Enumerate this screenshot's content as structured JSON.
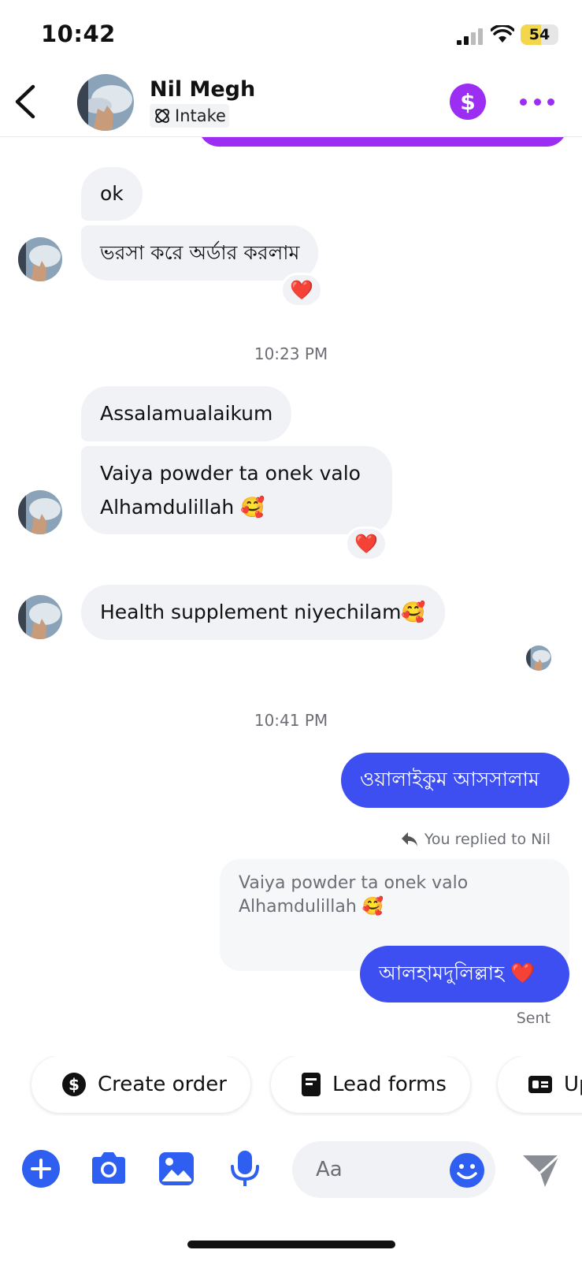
{
  "status_bar": {
    "time": "10:42",
    "battery": "54",
    "battery_level": 0.54
  },
  "header": {
    "name": "Nil Megh",
    "label_tag": "Intake",
    "accent_color": "#9b2ef2"
  },
  "messages": {
    "m1": "ok",
    "m2": "ভরসা করে অর্ডার করলাম",
    "ts1": "10:23 PM",
    "m3": "Assalamualaikum",
    "m4_line1": "Vaiya powder ta onek valo",
    "m4_line2": "Alhamdulillah 🥰",
    "m5": "Health supplement niyechilam🥰",
    "ts2": "10:41 PM",
    "out1": "ওয়ালাইকুম আসসালাম",
    "reply_note": "You replied to Nil",
    "quoted_line1": "Vaiya powder ta onek valo",
    "quoted_line2": "Alhamdulillah 🥰",
    "out2": "আলহামদুলিল্লাহ ❤️",
    "sent_status": "Sent",
    "reaction": "❤️"
  },
  "colors": {
    "outgoing_bubble": "#3d4ff0",
    "incoming_bubble": "#f1f2f5",
    "accent": "#9b2ef2",
    "composer_icons": "#2f5ff0"
  },
  "quick_actions": [
    {
      "label": "Create order",
      "icon": "dollar-circle-icon"
    },
    {
      "label": "Lead forms",
      "icon": "form-icon"
    },
    {
      "label": "Up",
      "icon": "id-card-icon"
    }
  ],
  "composer": {
    "placeholder": "Aa",
    "icons": [
      "plus-icon",
      "camera-icon",
      "gallery-icon",
      "microphone-icon",
      "emoji-icon",
      "send-icon"
    ]
  }
}
